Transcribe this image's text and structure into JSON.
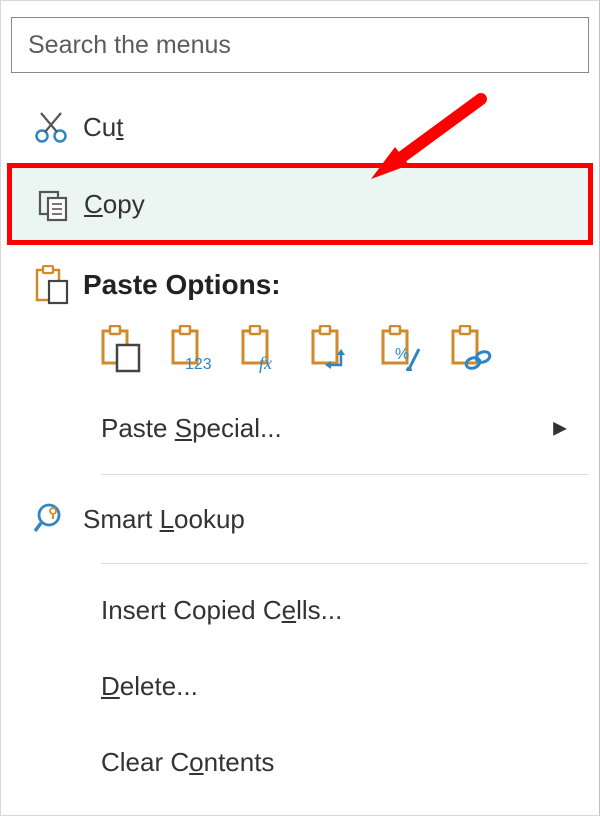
{
  "search": {
    "placeholder": "Search the menus"
  },
  "items": {
    "cut": "Cut",
    "copy": "Copy",
    "paste_header": "Paste Options:",
    "paste_special": "Paste Special...",
    "smart_lookup": "Smart Lookup",
    "insert_copied_cells": "Insert Copied Cells...",
    "delete": "Delete...",
    "clear_contents": "Clear Contents"
  },
  "access_keys": {
    "cut": "t",
    "copy": "C",
    "paste_special": "S",
    "smart_lookup": "L",
    "insert_copied_cells": "e",
    "delete": "D",
    "clear_contents": "o"
  },
  "paste_options": [
    "paste",
    "paste-values",
    "paste-formulas",
    "paste-transpose",
    "paste-formatting",
    "paste-link"
  ],
  "highlight": "copy"
}
